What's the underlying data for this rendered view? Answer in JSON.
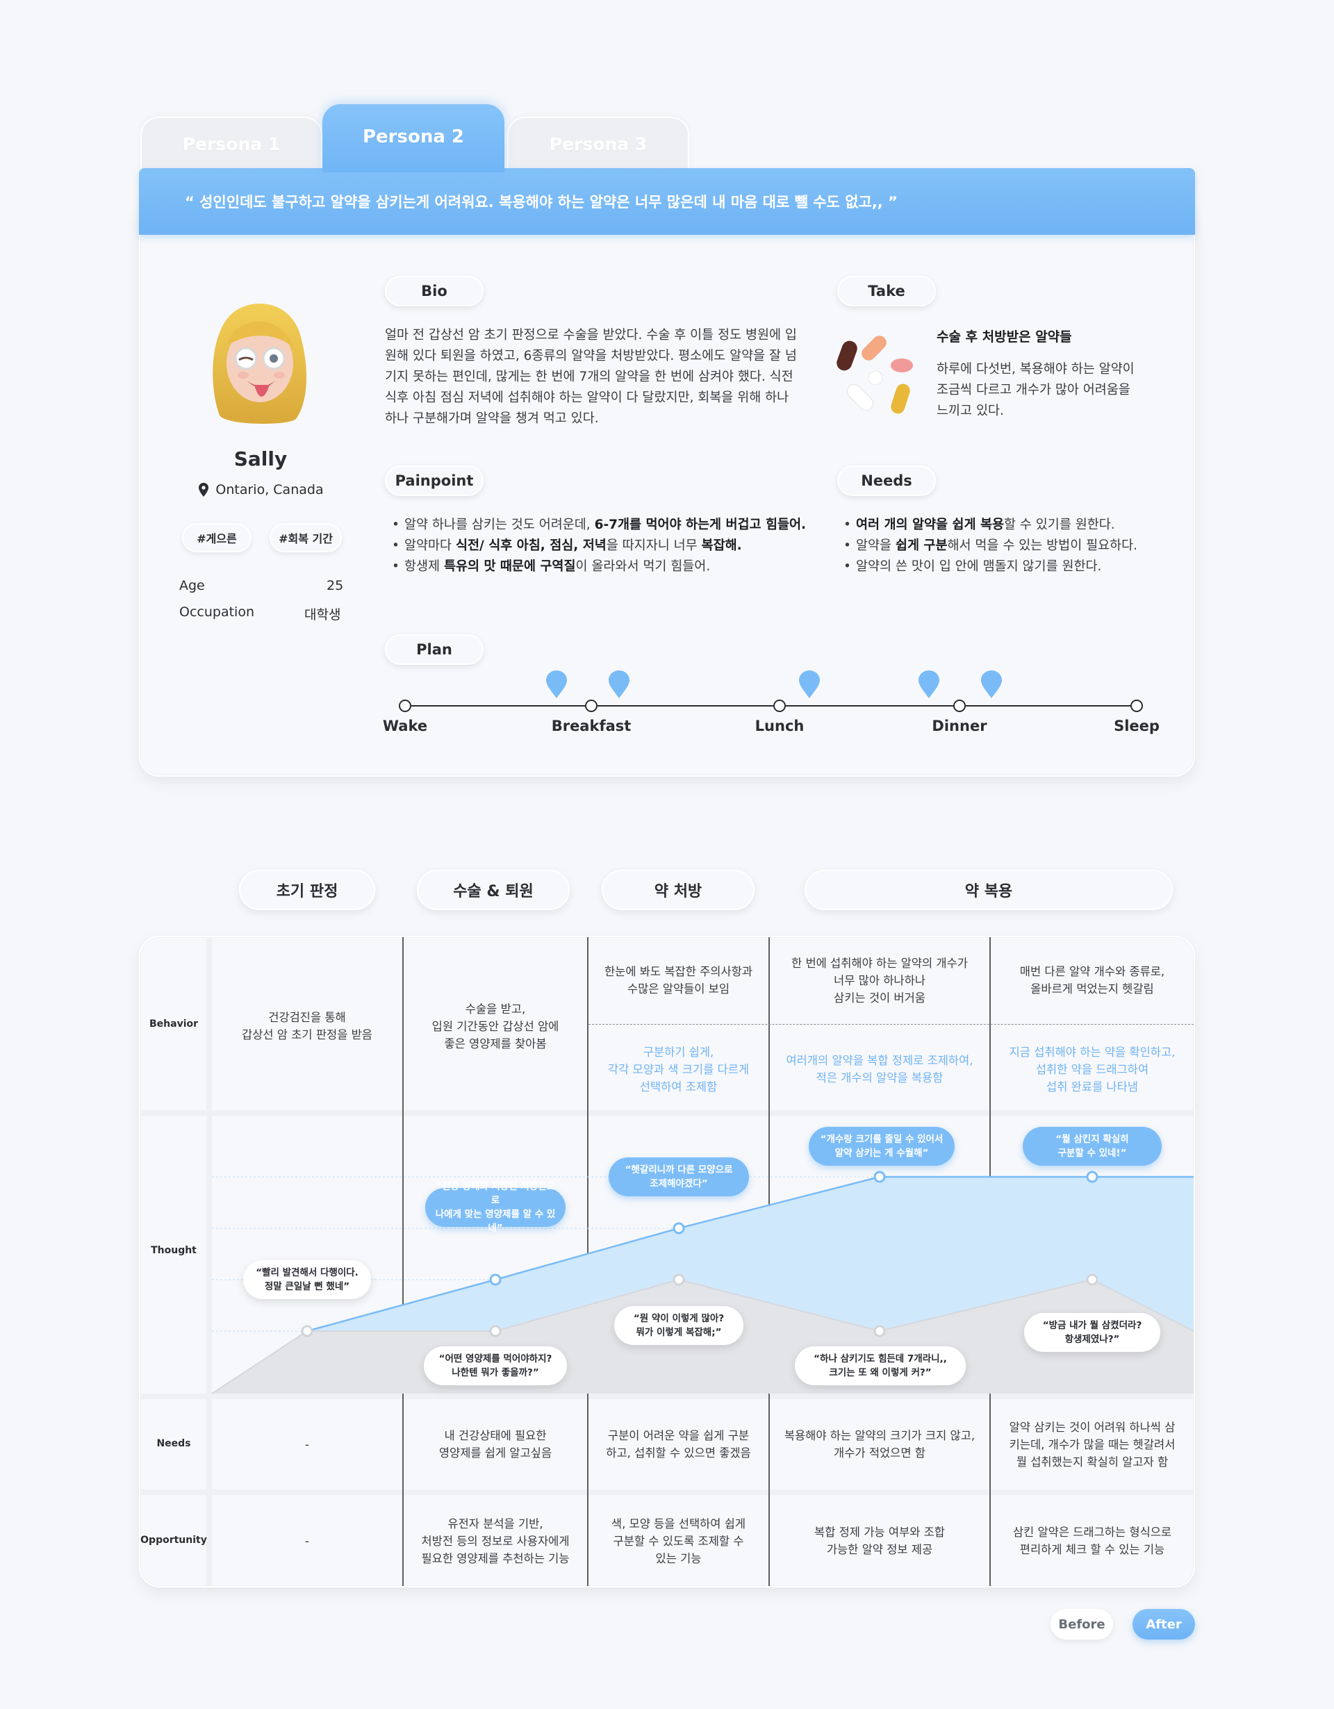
{
  "tabs": [
    {
      "label": "Persona 1",
      "active": false
    },
    {
      "label": "Persona 2",
      "active": true
    },
    {
      "label": "Persona 3",
      "active": false
    }
  ],
  "quote": "“ 성인인데도 불구하고 알약을 삼키는게 어려워요. 복용해야 하는 알약은 너무 많은데 내 마음 대로 뺄 수도 없고,, ”",
  "profile": {
    "name": "Sally",
    "location": "Ontario, Canada",
    "tags": [
      "#게으른",
      "#회복 기간"
    ],
    "age_label": "Age",
    "age_value": "25",
    "occupation_label": "Occupation",
    "occupation_value": "대학생"
  },
  "bio": {
    "label": "Bio",
    "text": "얼마 전 갑상선 암 초기 판정으로 수술을 받았다. 수술 후 이틀 정도 병원에 입원해 있다 퇴원을 하였고, 6종류의 알약을 처방받았다. 평소에도 알약을 잘 넘기지 못하는 편인데, 많게는 한 번에 7개의 알약을 한 번에 삼켜야 했다. 식전 식후 아침 점심 저녁에 섭취해야 하는 알약이 다 달랐지만, 회복을 위해 하나 하나 구분해가며 알약을 챙겨 먹고 있다."
  },
  "take": {
    "label": "Take",
    "title": "수술 후 처방받은 알약들",
    "text": "하루에 다섯번, 복용해야 하는 알약이 조금씩 다르고 개수가 많아 어려움을 느끼고 있다."
  },
  "painpoint": {
    "label": "Painpoint",
    "items": [
      {
        "pre": "알약 하나를 삼키는 것도 어려운데, ",
        "b1": "6-7개를 먹어야 하는게 버겁고 힘들어.",
        "mid": "",
        "b2": "",
        "post": ""
      },
      {
        "pre": "알약마다 ",
        "b1": "식전/ 식후 아침, 점심, 저녁",
        "mid": "을 따지자니 너무 ",
        "b2": "복잡해.",
        "post": ""
      },
      {
        "pre": "항생제 ",
        "b1": "특유의 맛 때문에 구역질",
        "mid": "이 올라와서 먹기 힘들어.",
        "b2": "",
        "post": ""
      }
    ]
  },
  "needs": {
    "label": "Needs",
    "items": [
      {
        "pre": "",
        "b1": "여러 개의 알약을 쉽게 복용",
        "mid": "할 수 있기를 원한다.",
        "b2": "",
        "post": ""
      },
      {
        "pre": "알약을 ",
        "b1": "쉽게 구분",
        "mid": "해서 먹을 수 있는 방법이 필요하다.",
        "b2": "",
        "post": ""
      },
      {
        "pre": "알약의 쓴 맛이 입 안에 맴돌지 않기를 원한다.",
        "b1": "",
        "mid": "",
        "b2": "",
        "post": ""
      }
    ]
  },
  "plan": {
    "label": "Plan",
    "points": [
      "Wake",
      "Breakfast",
      "Lunch",
      "Dinner",
      "Sleep"
    ]
  },
  "journey": {
    "stages": [
      "초기 판정",
      "수술 & 퇴원",
      "약 처방",
      "약 복용"
    ],
    "row_labels": [
      "Behavior",
      "Thought",
      "Needs",
      "Opportunity"
    ],
    "behavior": [
      {
        "main": "건강검진을 통해\n갑상선 암 초기 판정을 받음",
        "after": ""
      },
      {
        "main": "수술을 받고,\n입원 기간동안 갑상선 암에\n좋은 영양제를 찾아봄",
        "after": ""
      },
      {
        "main": "한눈에 봐도 복잡한 주의사항과\n수많은 알약들이 보임",
        "after": "구분하기 쉽게,\n각각 모양과 색 크기를 다르게\n선택하여 조제함"
      },
      {
        "main": "한 번에 섭취해야 하는 알약의 개수가\n너무 많아 하나하나\n삼키는 것이 버거움",
        "after": "여러개의 알약을 복합 정제로 조제하여,\n적은 개수의 알약을 복용함"
      },
      {
        "main": "매번 다른 알약 개수와 종류로,\n올바르게 먹었는지 헷갈림",
        "after": "지금 섭취해야 하는 약을 확인하고,\n섭취한 약을 드래그하여\n섭취 완료를 나타냄"
      }
    ],
    "thought_before": [
      "“빨리 발견해서 다행이다.\n정말 큰일날 뻔 했네”",
      "“어떤 영양제를 먹어야하지?\n나한텐 뭐가 좋을까?”",
      "“뭔 약이 이렇게 많아?\n뭐가 이렇게 복잡해;”",
      "“하나 삼키기도 힘든데 7개라니,,\n크기는 또 왜 이렇게 커?”",
      "“방금 내가 뭘 삼켰더라?\n항생제였나?”"
    ],
    "thought_after": [
      "“건강 상태와 저장된 처방전으로\n나에게 맞는 영양제를 알 수 있네”",
      "“헷갈리니까 다른 모양으로\n조제해야겠다”",
      "“개수랑 크기를 줄일 수 있어서\n알약 삼키는 게 수월해”",
      "“뭘 삼킨지 확실히\n구분할 수 있네!”"
    ],
    "needs": [
      "-",
      "내 건강상태에 필요한\n영양제를 쉽게 알고싶음",
      "구분이 어려운 약을 쉽게 구분\n하고, 섭취할 수 있으면 좋겠음",
      "복용해야 하는 알약의 크기가 크지 않고,\n개수가 적었으면 함",
      "알약 삼키는 것이 어려워 하나씩 삼\n키는데, 개수가 많을 때는 헷갈려서\n뭘 섭취했는지 확실히 알고자 함"
    ],
    "opportunity": [
      "-",
      "유전자 분석을 기반,\n처방전 등의 정보로 사용자에게\n필요한 영양제를 추천하는 기능",
      "색, 모양 등을 선택하여 쉽게\n구분할 수 있도록 조제할 수\n있는 기능",
      "복합 정제 가능 여부와 조합\n가능한 알약 정보 제공",
      "삼킨 알약은 드래그하는 형식으로\n편리하게 체크 할 수 있는 기능"
    ]
  },
  "toggle": {
    "before": "Before",
    "after": "After"
  },
  "colors": {
    "accent": "#70b5f6",
    "fill_after": "#cfe8fc",
    "fill_before": "#e5e6e9"
  }
}
